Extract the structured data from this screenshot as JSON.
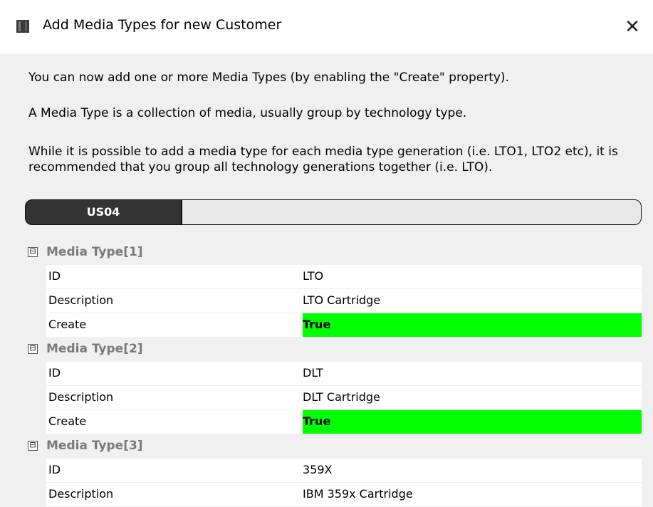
{
  "window": {
    "title": "Add Media Types for new Customer",
    "close_glyph": "✕",
    "icon": "application-icon"
  },
  "intro": [
    "You can now add one or more Media Types (by enabling the \"Create\" property).",
    "A Media Type is a collection of media, usually group by technology type.",
    "While it is possible to add a media type for each media type generation (i.e. LTO1, LTO2 etc), it is recommended that you group all technology generations together (i.e. LTO)."
  ],
  "tabs": [
    {
      "label": "US04",
      "active": true
    },
    {
      "label": "",
      "active": false
    }
  ],
  "colors": {
    "true_highlight": "#00ff00",
    "active_tab": "#333333",
    "category_text": "#7a7a7a"
  },
  "property_grid": {
    "categories": [
      {
        "label": "Media Type[1]",
        "toggle": "⊟",
        "properties": [
          {
            "name": "ID",
            "value": "LTO"
          },
          {
            "name": "Description",
            "value": "LTO Cartridge"
          },
          {
            "name": "Create",
            "value": "True"
          }
        ]
      },
      {
        "label": "Media Type[2]",
        "toggle": "⊟",
        "properties": [
          {
            "name": "ID",
            "value": "DLT"
          },
          {
            "name": "Description",
            "value": "DLT Cartridge"
          },
          {
            "name": "Create",
            "value": "True"
          }
        ]
      },
      {
        "label": "Media Type[3]",
        "toggle": "⊟",
        "properties": [
          {
            "name": "ID",
            "value": "359X"
          },
          {
            "name": "Description",
            "value": "IBM 359x Cartridge"
          }
        ]
      }
    ]
  }
}
